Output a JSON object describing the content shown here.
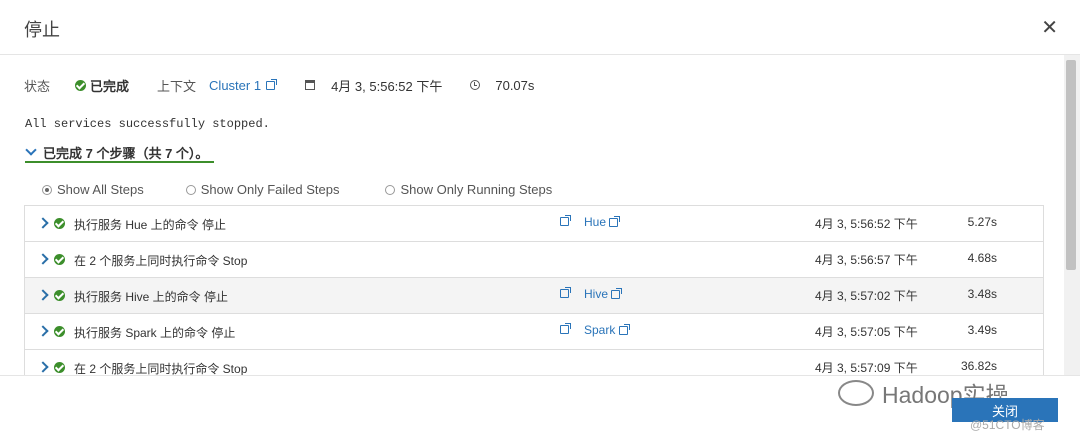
{
  "dialog": {
    "title": "停止",
    "close_symbol": "✕"
  },
  "meta": {
    "status_label": "状态",
    "status_value": "已完成",
    "context_label": "上下文",
    "context_link": "Cluster 1",
    "date": "4月 3, 5:56:52 下午",
    "duration": "70.07s"
  },
  "message": "All services successfully stopped.",
  "summary": "已完成 7 个步骤（共 7 个）。",
  "filters": [
    {
      "label": "Show All Steps",
      "selected": true
    },
    {
      "label": "Show Only Failed Steps",
      "selected": false
    },
    {
      "label": "Show Only Running Steps",
      "selected": false
    }
  ],
  "steps": [
    {
      "command": "执行服务 Hue 上的命令 停止",
      "service": "Hue",
      "time": "4月 3, 5:56:52 下午",
      "duration": "5.27s"
    },
    {
      "command": "在 2 个服务上同时执行命令 Stop",
      "service": "",
      "time": "4月 3, 5:56:57 下午",
      "duration": "4.68s"
    },
    {
      "command": "执行服务 Hive 上的命令 停止",
      "service": "Hive",
      "time": "4月 3, 5:57:02 下午",
      "duration": "3.48s"
    },
    {
      "command": "执行服务 Spark 上的命令 停止",
      "service": "Spark",
      "time": "4月 3, 5:57:05 下午",
      "duration": "3.49s"
    },
    {
      "command": "在 2 个服务上同时执行命令 Stop",
      "service": "",
      "time": "4月 3, 5:57:09 下午",
      "duration": "36.82s"
    }
  ],
  "footer": {
    "close_button": "关闭",
    "watermark": "Hadoop实操",
    "watermark_sub": "@51CTO博客"
  },
  "colors": {
    "success": "#3c8e2b",
    "link": "#2a74b9",
    "primary_button": "#2a74b9"
  }
}
